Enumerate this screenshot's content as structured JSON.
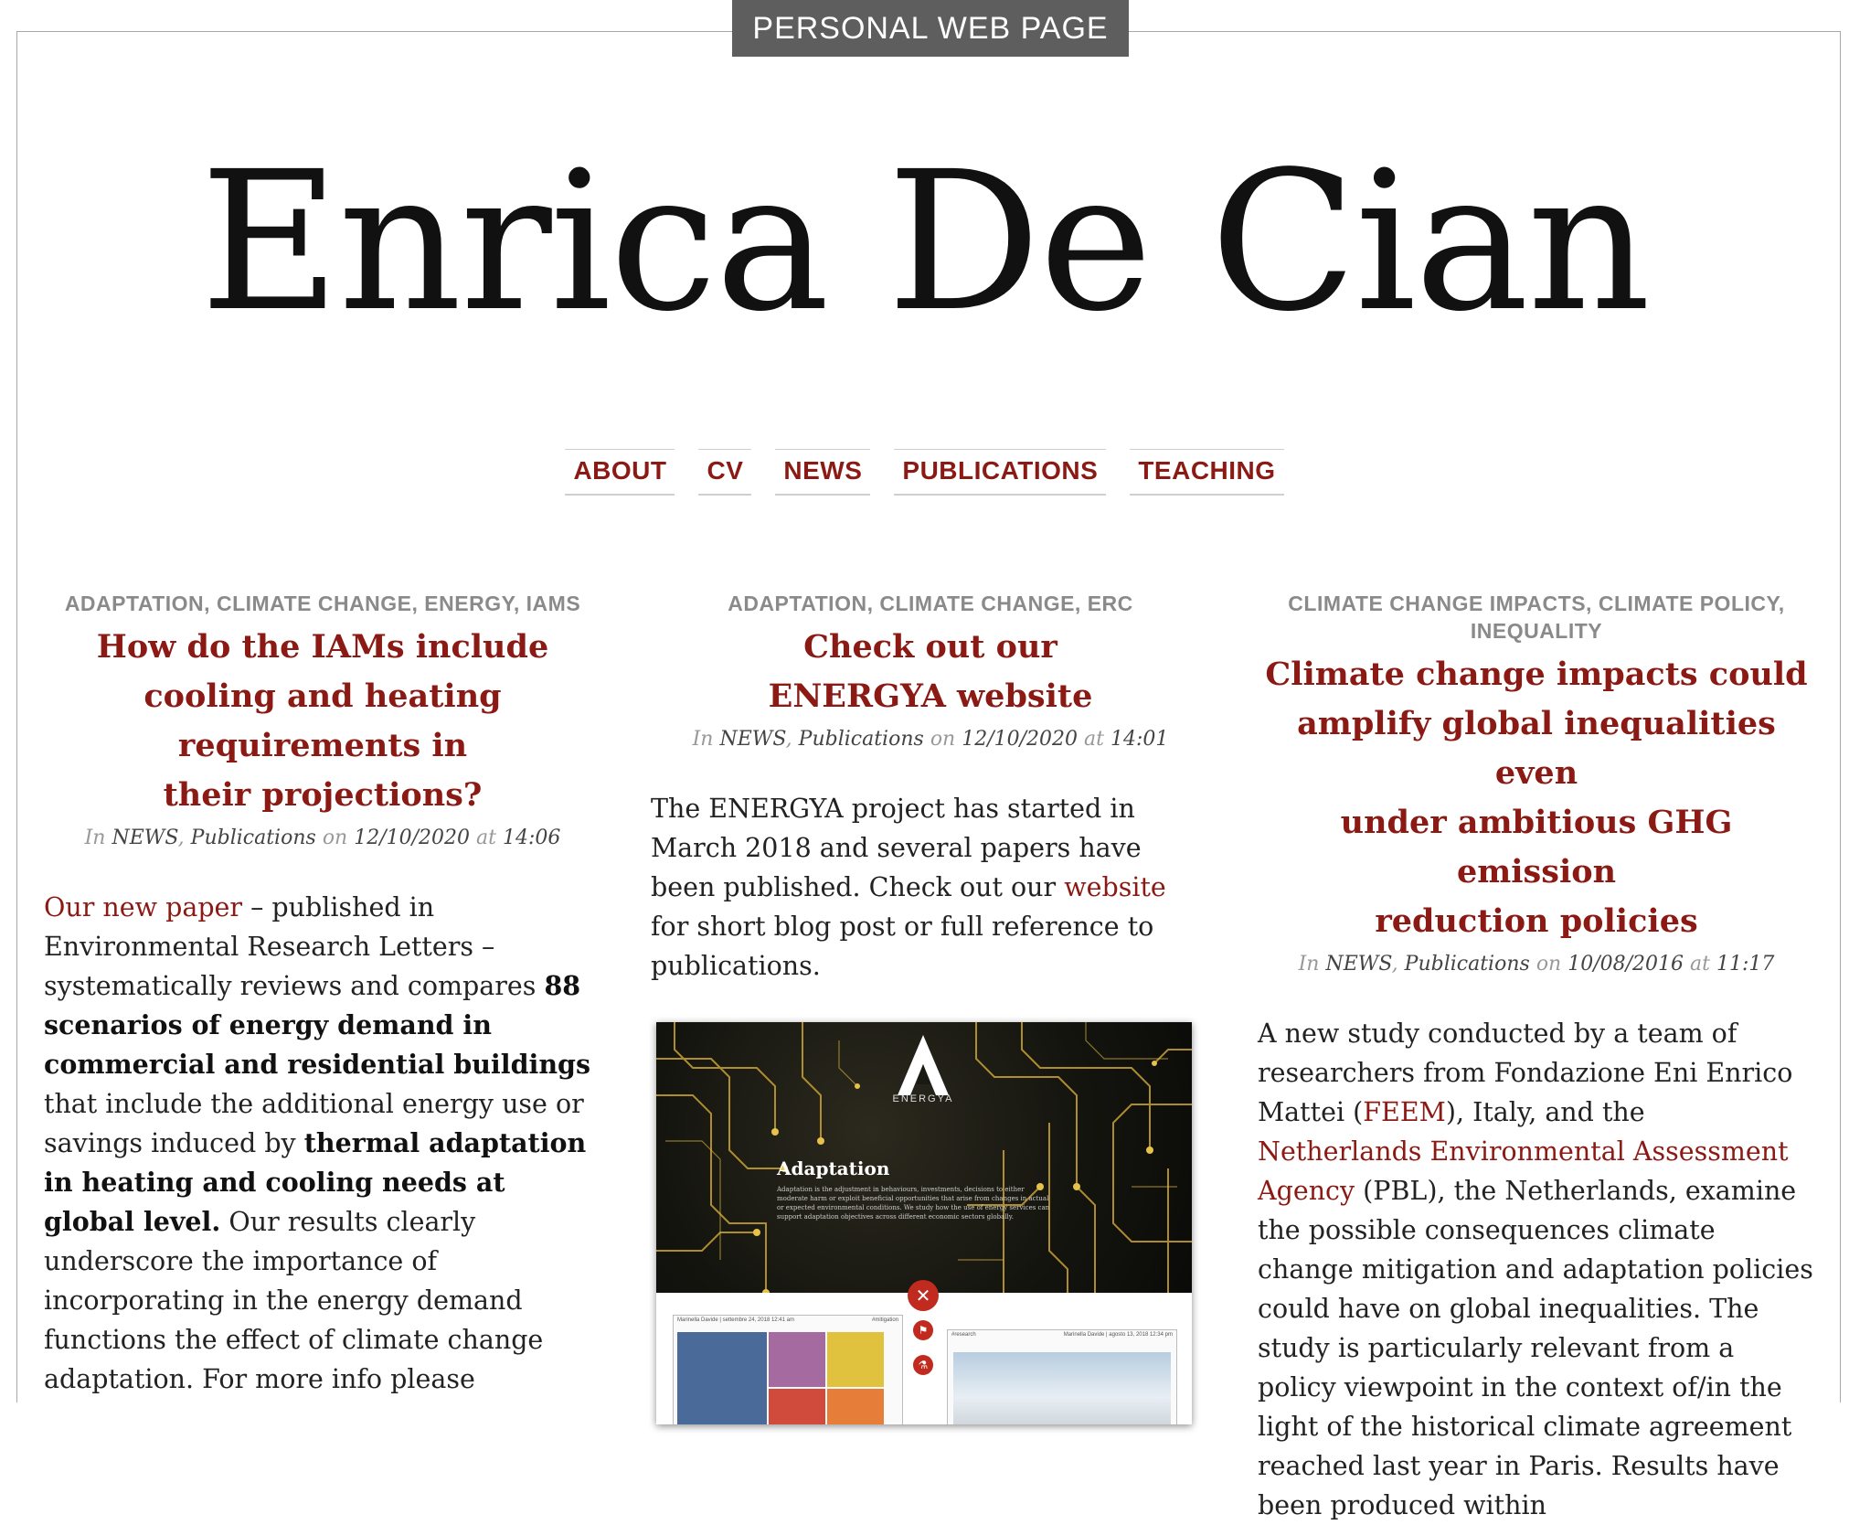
{
  "tag": "PERSONAL WEB PAGE",
  "site_title": "Enrica De Cian",
  "nav": [
    "ABOUT",
    "CV",
    "NEWS",
    "PUBLICATIONS",
    "TEACHING"
  ],
  "posts": [
    {
      "categories": [
        "ADAPTATION",
        "CLIMATE CHANGE",
        "ENERGY",
        "IAMS"
      ],
      "title_lines": [
        "How do the IAMs include",
        "cooling and heating",
        "requirements in",
        "their projections?"
      ],
      "meta": {
        "in": "In",
        "cat1": "NEWS",
        "cat2": "Publications",
        "on": "on",
        "date": "12/10/2020",
        "at": "at",
        "time": "14:06"
      },
      "body": {
        "link": "Our new paper",
        "t1": " – published in Environmental Research Letters – systematically reviews and compares ",
        "b1": "88 scenarios of energy demand in commercial and residential buildings",
        "t2": " that include the additional energy use or savings induced by ",
        "b2": "thermal adaptation in heating and cooling needs at global level.",
        "t3": " Our results clearly underscore the importance of incorporating in the energy demand functions the effect of climate change adaptation. For more info please"
      }
    },
    {
      "categories": [
        "ADAPTATION",
        "CLIMATE CHANGE",
        "ERC"
      ],
      "title_lines": [
        "Check out our",
        "ENERGYA website"
      ],
      "meta": {
        "in": "In",
        "cat1": "NEWS",
        "cat2": "Publications",
        "on": "on",
        "date": "12/10/2020",
        "at": "at",
        "time": "14:01"
      },
      "body": {
        "t1": "The ENERGYA project has started in March 2018 and several papers have been published. Check out our ",
        "link": "website",
        "t2": " for short blog post or full reference to publications."
      },
      "image": {
        "logo": "ENERGYA",
        "heading": "Adaptation",
        "text": "Adaptation is the adjustment in behaviours, investments, decisions to either moderate harm or exploit beneficial opportunities that arise from changes in actual or expected environmental conditions. We study how the use of energy services can support adaptation objectives across different economic sectors globally.",
        "card1_author": "Marinella Davide | settembre 24, 2018 12:41 am",
        "card1_tag": "#mitigation",
        "card2_tag": "#research",
        "card2_author": "Marinella Davide | agosto 13, 2018 12:34 pm",
        "icon1": "close-circle-icon",
        "icon2": "flag-icon",
        "icon3": "flask-icon"
      }
    },
    {
      "categories": [
        "CLIMATE CHANGE IMPACTS",
        "CLIMATE POLICY",
        "INEQUALITY"
      ],
      "title_lines": [
        "Climate change impacts could",
        "amplify global inequalities even",
        "under ambitious GHG emission",
        "reduction policies"
      ],
      "meta": {
        "in": "In",
        "cat1": "NEWS",
        "cat2": "Publications",
        "on": "on",
        "date": "10/08/2016",
        "at": "at",
        "time": "11:17"
      },
      "body": {
        "t1": "A new study conducted by a team of researchers from Fondazione Eni Enrico Mattei (",
        "link1": "FEEM",
        "t2": "), Italy,  and the ",
        "link2": "Netherlands Environmental Assessment Agency",
        "t3": " (PBL), the Netherlands, examine the possible consequences climate change mitigation and adaptation policies could have on global inequalities. The study is particularly relevant from a policy viewpoint in the context of/in the light of the historical climate agreement reached last year in Paris. Results have been produced within"
      }
    }
  ],
  "colors": {
    "accent": "#8b1a14",
    "category": "#8a8a8a",
    "tag_bg": "#5e5e5e"
  }
}
